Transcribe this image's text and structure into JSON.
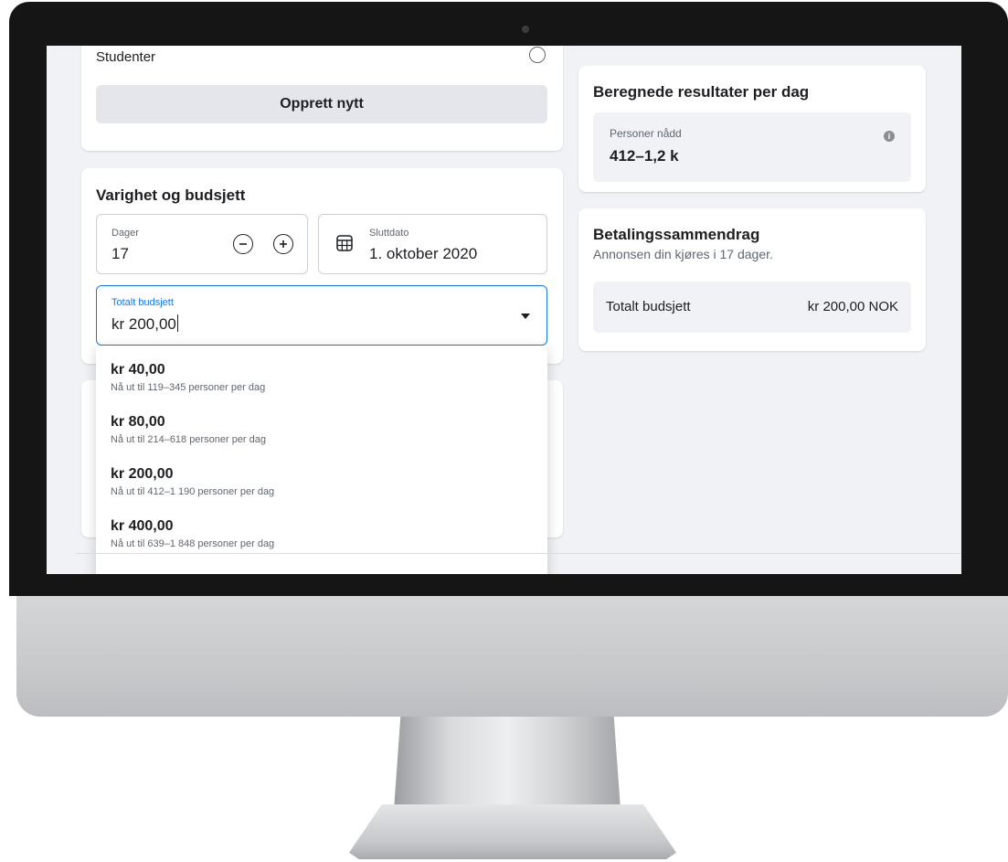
{
  "audience": {
    "option_label": "Studenter",
    "create_button": "Opprett nytt"
  },
  "duration_budget": {
    "title": "Varighet og budsjett",
    "days_label": "Dager",
    "days_value": "17",
    "end_date_label": "Sluttdato",
    "end_date_value": "1. oktober 2020",
    "total_budget_label": "Totalt budsjett",
    "total_budget_value": "kr 200,00",
    "options": [
      {
        "price": "kr 40,00",
        "desc": "Nå ut til 119–345 personer per dag"
      },
      {
        "price": "kr 80,00",
        "desc": "Nå ut til 214–618 personer per dag"
      },
      {
        "price": "kr 200,00",
        "desc": "Nå ut til 412–1 190 personer per dag"
      },
      {
        "price": "kr 400,00",
        "desc": "Nå ut til 639–1 848 personer per dag"
      }
    ]
  },
  "results": {
    "title": "Beregnede resultater per dag",
    "metric_label": "Personer nådd",
    "metric_value": "412–1,2 k"
  },
  "payment": {
    "title": "Betalingssammendrag",
    "subtitle": "Annonsen din kjøres i 17 dager.",
    "row_label": "Totalt budsjett",
    "row_value": "kr 200,00 NOK"
  },
  "colors": {
    "accent": "#1877f2",
    "page_bg": "#f0f2f5",
    "text": "#1c1e21",
    "secondary_text": "#606770"
  },
  "icons": [
    "minus-circle-icon",
    "plus-circle-icon",
    "calendar-icon",
    "dropdown-arrow-icon",
    "info-icon"
  ]
}
